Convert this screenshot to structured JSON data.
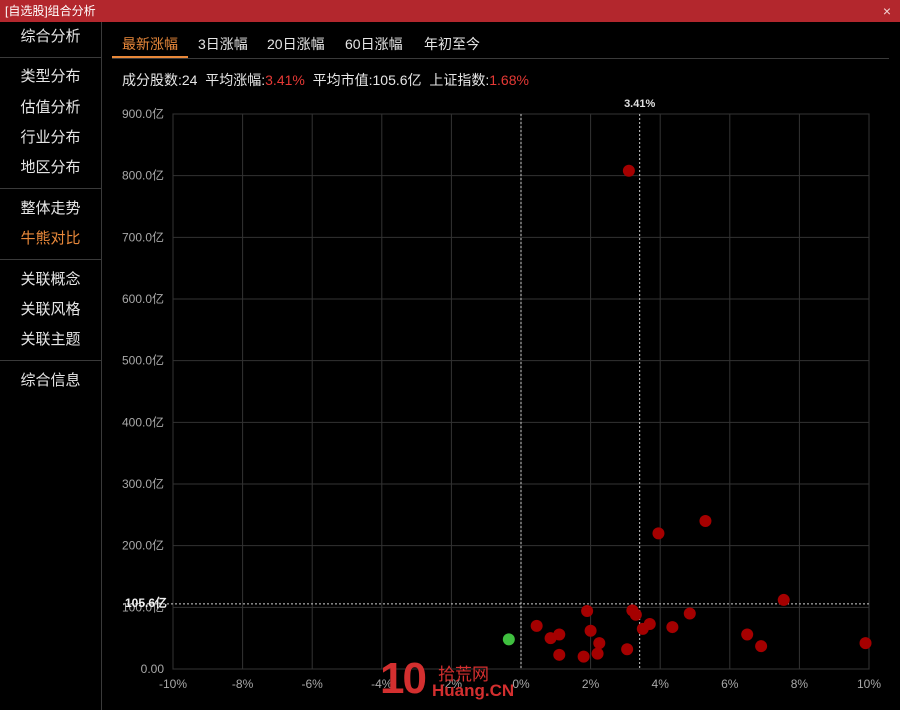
{
  "window": {
    "title": "[自选股]组合分析",
    "close_icon": "×"
  },
  "sidebar": {
    "items": [
      {
        "label": "综合分析",
        "active": false
      },
      {
        "label": "类型分布",
        "active": false
      },
      {
        "label": "估值分析",
        "active": false
      },
      {
        "label": "行业分布",
        "active": false
      },
      {
        "label": "地区分布",
        "active": false
      },
      {
        "label": "整体走势",
        "active": false
      },
      {
        "label": "牛熊对比",
        "active": true
      },
      {
        "label": "关联概念",
        "active": false
      },
      {
        "label": "关联风格",
        "active": false
      },
      {
        "label": "关联主题",
        "active": false
      },
      {
        "label": "综合信息",
        "active": false
      }
    ]
  },
  "tabs": [
    {
      "label": "最新涨幅",
      "active": true
    },
    {
      "label": "3日涨幅",
      "active": false
    },
    {
      "label": "20日涨幅",
      "active": false
    },
    {
      "label": "60日涨幅",
      "active": false
    },
    {
      "label": "年初至今",
      "active": false
    }
  ],
  "stats": {
    "count_label": "成分股数:",
    "count_value": "24",
    "avg_change_label": "平均涨幅:",
    "avg_change_value": "3.41%",
    "avg_mcap_label": "平均市值:",
    "avg_mcap_value": "105.6亿",
    "index_label": "上证指数:",
    "index_value": "1.68%"
  },
  "colors": {
    "up": "#a50000",
    "down": "#3fbf3f",
    "accent": "#e8883a",
    "title_bar": "#b3272d",
    "stat_red": "#e53935"
  },
  "watermark": {
    "number": "10",
    "cn_text": "拾荒网",
    "en_text": "Huang.CN"
  },
  "chart_data": {
    "type": "scatter",
    "xlim": [
      -10,
      10
    ],
    "ylim": [
      0,
      900
    ],
    "x_ticks": [
      -10,
      -8,
      -6,
      -4,
      -2,
      0,
      2,
      4,
      6,
      8,
      10
    ],
    "x_tick_labels": [
      "-10%",
      "-8%",
      "-6%",
      "-4%",
      "-2%",
      "0%",
      "2%",
      "4%",
      "6%",
      "8%",
      "10%"
    ],
    "y_ticks": [
      0,
      100,
      200,
      300,
      400,
      500,
      600,
      700,
      800,
      900
    ],
    "y_tick_labels": [
      "0.00",
      "100.0亿",
      "200.0亿",
      "300.0亿",
      "400.0亿",
      "500.0亿",
      "600.0亿",
      "700.0亿",
      "800.0亿",
      "900.0亿"
    ],
    "grid": true,
    "zero_line_x": 0,
    "avg_x": 3.41,
    "avg_x_label": "3.41%",
    "avg_y": 105.6,
    "avg_y_label": "105.6亿",
    "points": [
      {
        "x": -0.35,
        "y": 48,
        "dir": "down"
      },
      {
        "x": 0.45,
        "y": 70,
        "dir": "up"
      },
      {
        "x": 0.85,
        "y": 50,
        "dir": "up"
      },
      {
        "x": 1.1,
        "y": 56,
        "dir": "up"
      },
      {
        "x": 1.1,
        "y": 23,
        "dir": "up"
      },
      {
        "x": 1.8,
        "y": 20,
        "dir": "up"
      },
      {
        "x": 1.9,
        "y": 94,
        "dir": "up"
      },
      {
        "x": 2.0,
        "y": 62,
        "dir": "up"
      },
      {
        "x": 2.2,
        "y": 25,
        "dir": "up"
      },
      {
        "x": 2.25,
        "y": 42,
        "dir": "up"
      },
      {
        "x": 3.05,
        "y": 32,
        "dir": "up"
      },
      {
        "x": 3.1,
        "y": 808,
        "dir": "up"
      },
      {
        "x": 3.2,
        "y": 95,
        "dir": "up"
      },
      {
        "x": 3.3,
        "y": 88,
        "dir": "up"
      },
      {
        "x": 3.5,
        "y": 65,
        "dir": "up"
      },
      {
        "x": 3.7,
        "y": 73,
        "dir": "up"
      },
      {
        "x": 3.95,
        "y": 220,
        "dir": "up"
      },
      {
        "x": 4.35,
        "y": 68,
        "dir": "up"
      },
      {
        "x": 4.85,
        "y": 90,
        "dir": "up"
      },
      {
        "x": 5.3,
        "y": 240,
        "dir": "up"
      },
      {
        "x": 6.5,
        "y": 56,
        "dir": "up"
      },
      {
        "x": 6.9,
        "y": 37,
        "dir": "up"
      },
      {
        "x": 7.55,
        "y": 112,
        "dir": "up"
      },
      {
        "x": 9.9,
        "y": 42,
        "dir": "up"
      }
    ]
  }
}
